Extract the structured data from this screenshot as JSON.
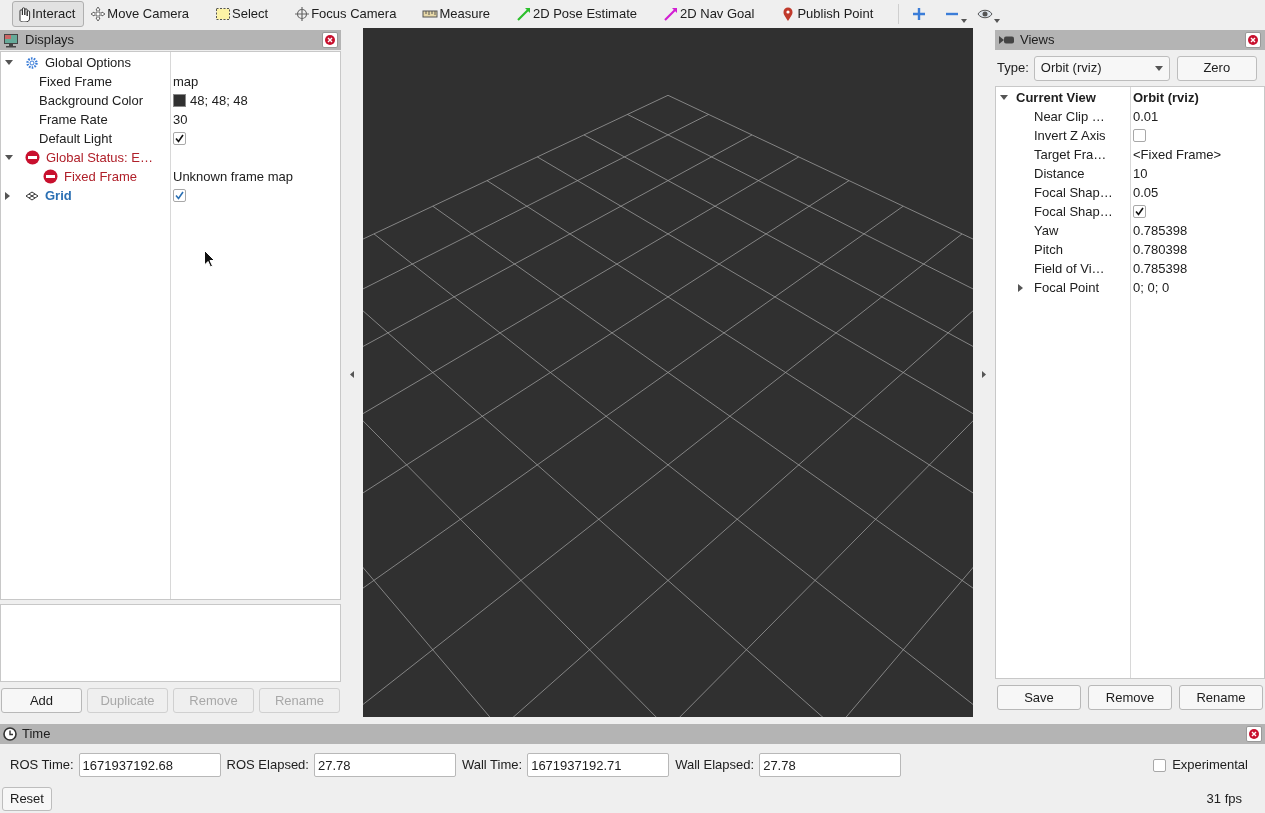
{
  "toolbar": {
    "tools": [
      {
        "kind": "hand",
        "label": "Interact",
        "selected": true
      },
      {
        "kind": "move",
        "label": "Move Camera",
        "selected": false
      },
      {
        "kind": "select",
        "label": "Select",
        "selected": false
      },
      {
        "kind": "focus",
        "label": "Focus Camera",
        "selected": false
      },
      {
        "kind": "measure",
        "label": "Measure",
        "selected": false
      },
      {
        "kind": "pose",
        "label": "2D Pose Estimate",
        "selected": false
      },
      {
        "kind": "nav",
        "label": "2D Nav Goal",
        "selected": false
      },
      {
        "kind": "point",
        "label": "Publish Point",
        "selected": false
      }
    ],
    "actions": [
      {
        "kind": "plus",
        "dropdown": false
      },
      {
        "kind": "minus",
        "dropdown": true
      },
      {
        "kind": "eye",
        "dropdown": true
      }
    ]
  },
  "displays": {
    "title": "Displays",
    "tree": [
      {
        "kind": "options",
        "label": "Global Options",
        "expanded": true,
        "children": [
          {
            "kind": "text",
            "label": "Fixed Frame",
            "value": "map"
          },
          {
            "kind": "color",
            "label": "Background Color",
            "value": "48; 48; 48",
            "color": "#303030"
          },
          {
            "kind": "text",
            "label": "Frame Rate",
            "value": "30"
          },
          {
            "kind": "checkbox",
            "label": "Default Light",
            "checked": true
          }
        ]
      },
      {
        "kind": "error",
        "label": "Global Status: E…",
        "expanded": true,
        "children": [
          {
            "kind": "error",
            "label": "Fixed Frame",
            "value": "Unknown frame map"
          }
        ]
      },
      {
        "kind": "display",
        "label": "Grid",
        "checked": true,
        "expanded": false
      }
    ],
    "buttons": [
      {
        "label": "Add",
        "disabled": false
      },
      {
        "label": "Duplicate",
        "disabled": true
      },
      {
        "label": "Remove",
        "disabled": true
      },
      {
        "label": "Rename",
        "disabled": true
      }
    ]
  },
  "views": {
    "title": "Views",
    "type_label": "Type:",
    "type_value": "Orbit (rviz)",
    "zero_button": "Zero",
    "tree": [
      {
        "kind": "header",
        "label": "Current View",
        "value": "Orbit (rviz)",
        "expanded": true,
        "children": [
          {
            "kind": "text",
            "label": "Near Clip …",
            "value": "0.01"
          },
          {
            "kind": "checkbox",
            "label": "Invert Z Axis",
            "checked": false
          },
          {
            "kind": "text",
            "label": "Target Fra…",
            "value": "<Fixed Frame>"
          },
          {
            "kind": "text",
            "label": "Distance",
            "value": "10"
          },
          {
            "kind": "text",
            "label": "Focal Shap…",
            "value": "0.05"
          },
          {
            "kind": "checkbox",
            "label": "Focal Shap…",
            "checked": true
          },
          {
            "kind": "text",
            "label": "Yaw",
            "value": "0.785398"
          },
          {
            "kind": "text",
            "label": "Pitch",
            "value": "0.780398"
          },
          {
            "kind": "text",
            "label": "Field of Vi…",
            "value": "0.785398"
          },
          {
            "kind": "text",
            "label": "Focal Point",
            "value": "0; 0; 0",
            "expanded": false
          }
        ]
      }
    ],
    "buttons": [
      {
        "label": "Save",
        "disabled": false
      },
      {
        "label": "Remove",
        "disabled": false
      },
      {
        "label": "Rename",
        "disabled": false
      }
    ]
  },
  "time": {
    "title": "Time",
    "fields": [
      {
        "label": "ROS Time:",
        "value": "1671937192.68"
      },
      {
        "label": "ROS Elapsed:",
        "value": "27.78"
      },
      {
        "label": "Wall Time:",
        "value": "1671937192.71"
      },
      {
        "label": "Wall Elapsed:",
        "value": "27.78"
      }
    ],
    "experimental": {
      "label": "Experimental",
      "checked": false
    },
    "reset_button": "Reset",
    "fps": "31 fps"
  }
}
